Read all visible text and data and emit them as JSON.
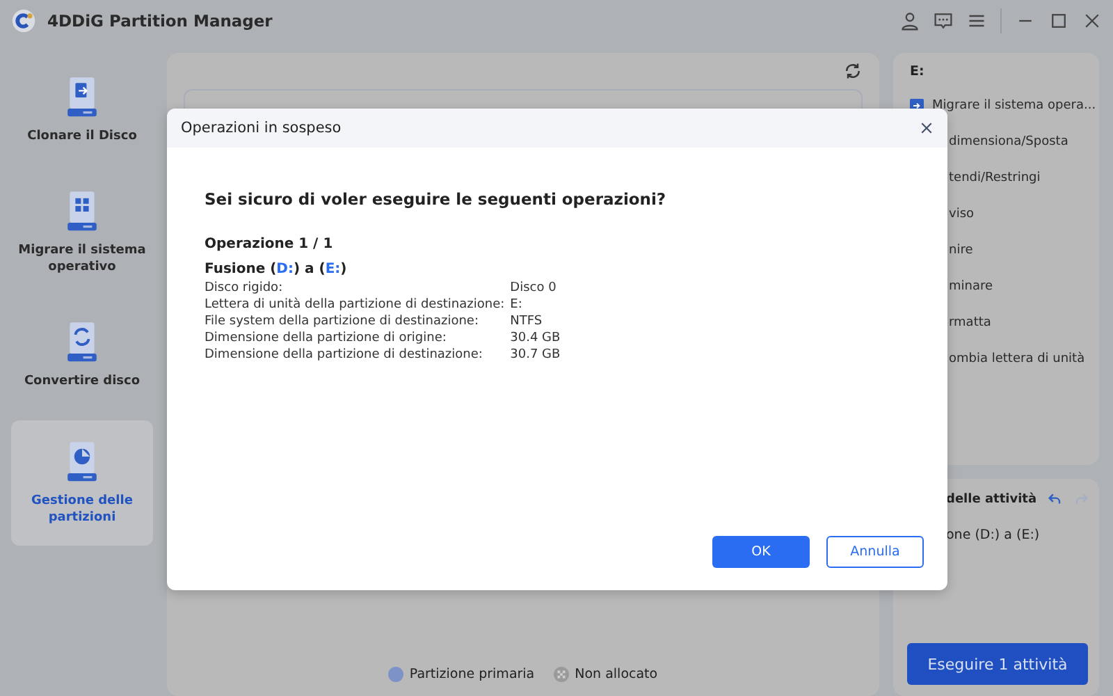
{
  "window": {
    "title": "4DDiG Partition Manager"
  },
  "sidebar": {
    "items": [
      {
        "label": "Clonare il Disco",
        "selected": false
      },
      {
        "label": "Migrare il sistema operativo",
        "selected": false
      },
      {
        "label": "Convertire disco",
        "selected": false
      },
      {
        "label": "Gestione delle partizioni",
        "selected": true
      }
    ]
  },
  "legend": [
    {
      "label": "Partizione primaria",
      "kind": "primary"
    },
    {
      "label": "Non allocato",
      "kind": "unallocated"
    }
  ],
  "actions_panel": {
    "drive": "E:",
    "items": [
      {
        "label": "Migrare il sistema opera...",
        "icon": true
      },
      {
        "label": "dimensiona/Sposta",
        "icon": false
      },
      {
        "label": "tendi/Restringi",
        "icon": false
      },
      {
        "label": "viso",
        "icon": false
      },
      {
        "label": "nire",
        "icon": false
      },
      {
        "label": "minare",
        "icon": false
      },
      {
        "label": "rmatta",
        "icon": false
      },
      {
        "label": "ombia lettera di unità",
        "icon": false
      }
    ]
  },
  "tasks_panel": {
    "title": "delle attività",
    "tasks": [
      "one (D:) a (E:)"
    ],
    "undo_enabled": true,
    "redo_enabled": false,
    "run_button": "Eseguire 1 attività"
  },
  "dialog": {
    "title": "Operazioni in sospeso",
    "question": "Sei sicuro di voler eseguire le seguenti operazioni?",
    "operation_counter": "Operazione 1 / 1",
    "operation_title": [
      {
        "text": "Fusione (",
        "highlight": false
      },
      {
        "text": "D:",
        "highlight": true
      },
      {
        "text": ") a (",
        "highlight": false
      },
      {
        "text": "E:",
        "highlight": true
      },
      {
        "text": ")",
        "highlight": false
      }
    ],
    "details": [
      {
        "label": "Disco rigido:",
        "value": "Disco 0"
      },
      {
        "label": "Lettera di unità della partizione di destinazione:",
        "value": "E:"
      },
      {
        "label": "File system della partizione di destinazione:",
        "value": "NTFS"
      },
      {
        "label": "Dimensione della partizione di origine:",
        "value": "30.4 GB"
      },
      {
        "label": "Dimensione della partizione di destinazione:",
        "value": "30.7 GB"
      }
    ],
    "buttons": [
      {
        "label": "OK",
        "kind": "primary"
      },
      {
        "label": "Annulla",
        "kind": "secondary"
      }
    ]
  }
}
